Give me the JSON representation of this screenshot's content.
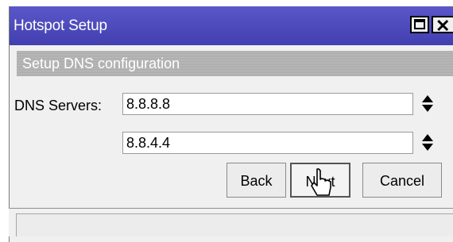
{
  "window": {
    "title": "Hotspot Setup"
  },
  "header": {
    "text": "Setup DNS configuration"
  },
  "dns": {
    "label": "DNS Servers:",
    "servers": [
      "8.8.8.8",
      "8.8.4.4"
    ]
  },
  "buttons": {
    "back": "Back",
    "next": "Next",
    "cancel": "Cancel"
  },
  "status": {
    "text": ""
  },
  "colors": {
    "titlebar": "#4a47bb",
    "header_bar": "#b3b3b3"
  }
}
